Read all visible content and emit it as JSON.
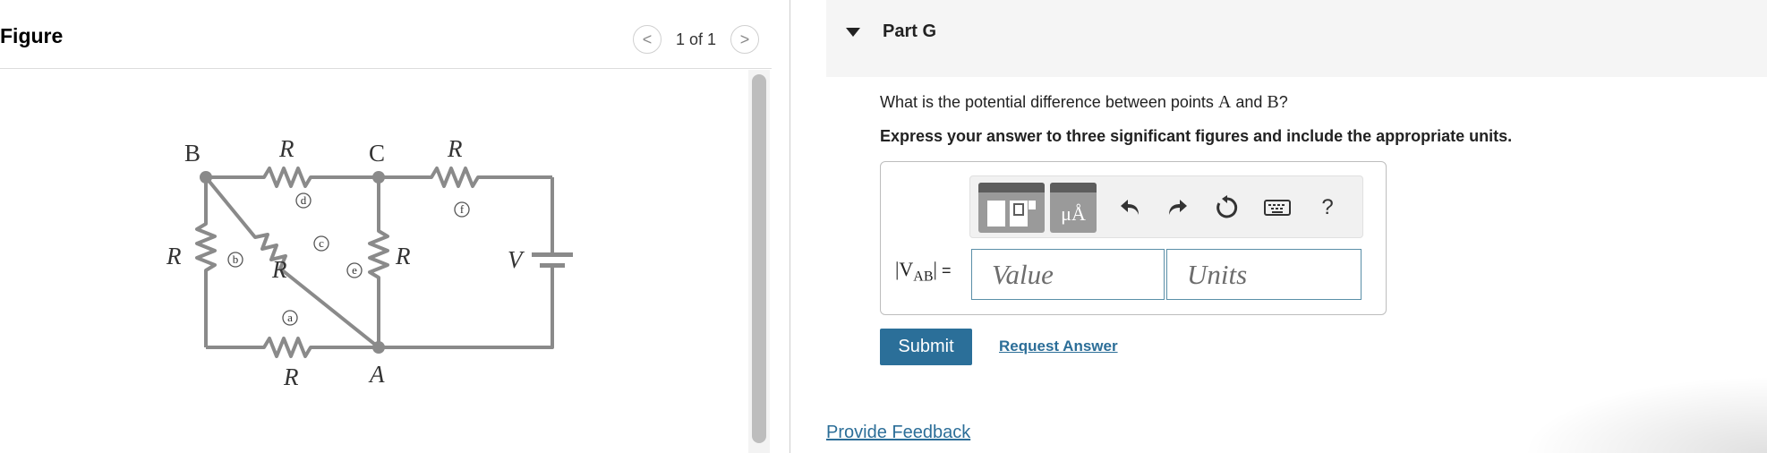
{
  "figure": {
    "title": "Figure",
    "pager": {
      "prev": "<",
      "text": "1 of 1",
      "next": ">"
    },
    "circuit": {
      "nodes": {
        "B": "B",
        "C": "C",
        "A": "A"
      },
      "resistor_label": "R",
      "battery_label": "V",
      "markers": {
        "a": "a",
        "b": "b",
        "c": "c",
        "d": "d",
        "e": "e",
        "f": "f"
      }
    }
  },
  "part": {
    "title": "Part G",
    "question_prefix": "What is the potential difference between points ",
    "point_a": "A",
    "question_and": " and ",
    "point_b": "B",
    "question_suffix": "?",
    "instruction": "Express your answer to three significant figures and include the appropriate units.",
    "answer": {
      "var_open": "|V",
      "var_sub": "AB",
      "var_close": "|",
      "equals": " =",
      "value_placeholder": "Value",
      "units_placeholder": "Units"
    },
    "toolbar": {
      "units_template_label": "μÅ",
      "help": "?"
    },
    "submit_label": "Submit",
    "request_label": "Request Answer"
  },
  "feedback_label": "Provide Feedback",
  "colors": {
    "accent": "#2b6f99",
    "link": "#2c6e98",
    "wire": "#888888"
  }
}
